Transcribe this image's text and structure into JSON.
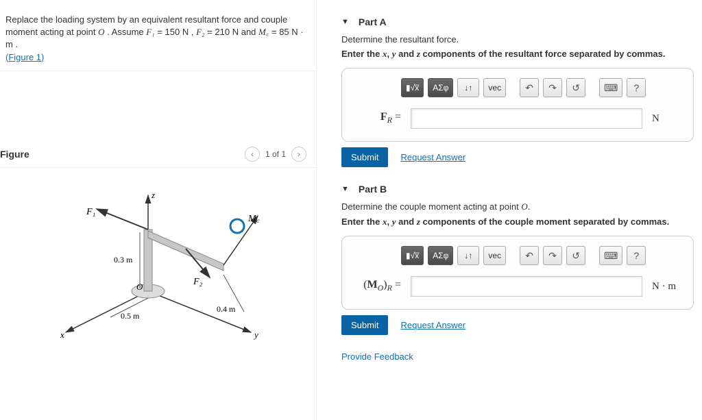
{
  "problem": {
    "line1_a": "Replace the loading system by an equivalent resultant force and couple moment acting at point ",
    "pointO": "O",
    "line1_b": ". Assume ",
    "f1_sym": "F₁",
    "f1_val": " = 150 N",
    "sep": " , ",
    "f2_sym": "F₂",
    "f2_val": " = 210 N",
    "and": " and ",
    "mc_sym": "M꜀",
    "mc_val": " = 85 N · m",
    "dot": " .",
    "figure_link": "(Figure 1)"
  },
  "figure": {
    "title": "Figure",
    "pager": "1 of 1",
    "labels": {
      "z": "z",
      "x": "x",
      "y": "y",
      "F1": "F₁",
      "F2": "F₂",
      "Mc": "M꜀",
      "O": "O",
      "d03": "0.3 m",
      "d05": "0.5 m",
      "d04": "0.4 m"
    }
  },
  "partA": {
    "title": "Part A",
    "desc": "Determine the resultant force.",
    "instr": "Enter the x, y and z components of the resultant force separated by commas.",
    "lhs": "F_R =",
    "unit": "N",
    "submit": "Submit",
    "request": "Request Answer"
  },
  "partB": {
    "title": "Part B",
    "desc": "Determine the couple moment acting at point O.",
    "instr": "Enter the x, y and z components of the couple moment separated by commas.",
    "lhs": "(M_O)_R =",
    "unit": "N · m",
    "submit": "Submit",
    "request": "Request Answer"
  },
  "toolbar": {
    "templates": "▮√x̅",
    "greek": "ΑΣφ",
    "subsup": "↓↑",
    "vec": "vec",
    "undo": "↶",
    "redo": "↷",
    "reset": "↺",
    "keyboard": "⌨",
    "help": "?"
  },
  "feedback": "Provide Feedback"
}
